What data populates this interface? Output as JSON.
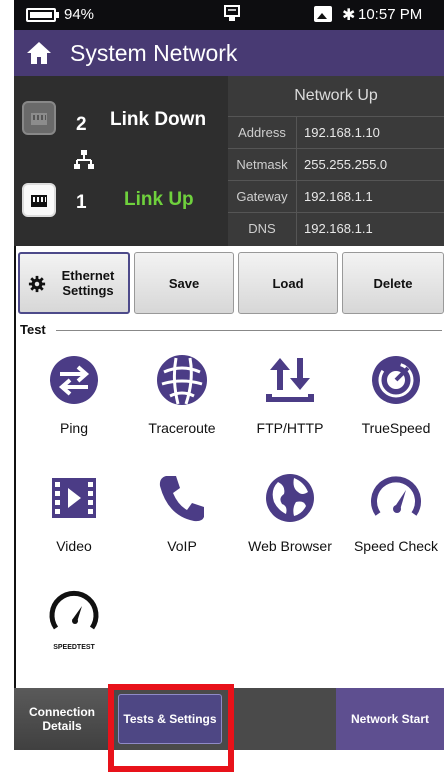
{
  "status_bar": {
    "battery": "94%",
    "time": "10:57 PM"
  },
  "title_bar": {
    "title": "System Network"
  },
  "network": {
    "ports": [
      {
        "number": "2",
        "state": "Link Down",
        "state_color": "#ffffff"
      },
      {
        "number": "1",
        "state": "Link Up",
        "state_color": "#6fd13d"
      }
    ],
    "header": "Network Up",
    "rows": [
      {
        "key": "Address",
        "value": "192.168.1.10"
      },
      {
        "key": "Netmask",
        "value": "255.255.255.0"
      },
      {
        "key": "Gateway",
        "value": "192.168.1.1"
      },
      {
        "key": "DNS",
        "value": "192.168.1.1"
      }
    ]
  },
  "toolbar": {
    "ethernet_settings": "Ethernet Settings",
    "save": "Save",
    "load": "Load",
    "delete": "Delete"
  },
  "test_section": {
    "label": "Test",
    "tiles": [
      {
        "label": "Ping",
        "icon": "ping-icon"
      },
      {
        "label": "Traceroute",
        "icon": "traceroute-icon"
      },
      {
        "label": "FTP/HTTP",
        "icon": "ftp-http-icon"
      },
      {
        "label": "TrueSpeed",
        "icon": "truespeed-icon"
      },
      {
        "label": "Video",
        "icon": "video-icon"
      },
      {
        "label": "VoIP",
        "icon": "phone-icon"
      },
      {
        "label": "Web Browser",
        "icon": "globe-icon"
      },
      {
        "label": "Speed Check",
        "icon": "speedometer-icon"
      },
      {
        "label": "SPEEDTEST",
        "icon": "speedtest-icon"
      }
    ]
  },
  "bottom_nav": {
    "connection_details": "Connection Details",
    "tests_settings": "Tests & Settings",
    "network_start": "Network Start"
  },
  "colors": {
    "accent": "#4b3c86",
    "highlight": "#e8121a",
    "link_up": "#6fd13d"
  }
}
